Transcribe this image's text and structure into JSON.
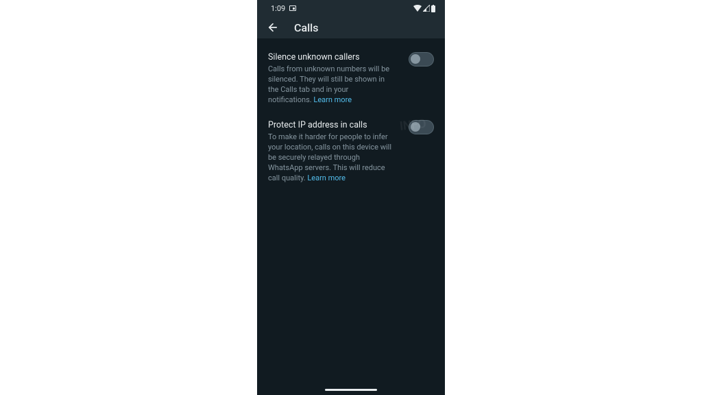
{
  "status_bar": {
    "time": "1:09"
  },
  "app_bar": {
    "title": "Calls"
  },
  "settings": {
    "silence": {
      "title": "Silence unknown callers",
      "description": "Calls from unknown numbers will be silenced. They will still be shown in the Calls tab and in your notifications. ",
      "learn_more": "Learn more",
      "enabled": false
    },
    "protect_ip": {
      "title": "Protect IP address in calls",
      "description": "To make it harder for people to infer your location, calls on this device will be securely relayed through WhatsApp servers. This will reduce call quality. ",
      "learn_more": "Learn more",
      "enabled": false
    }
  },
  "watermark": "INFO"
}
